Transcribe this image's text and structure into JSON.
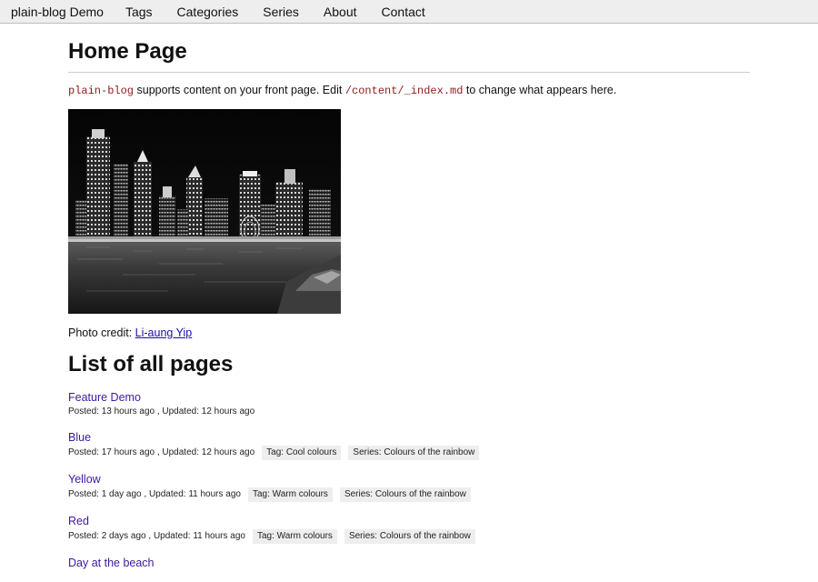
{
  "nav": {
    "brand": "plain-blog Demo",
    "items": [
      "Tags",
      "Categories",
      "Series",
      "About",
      "Contact"
    ]
  },
  "page": {
    "title": "Home Page",
    "intro": {
      "code1": "plain-blog",
      "text1": " supports content on your front page. Edit ",
      "code2": "/content/_index.md",
      "text2": " to change what appears here."
    },
    "photo_alt": "Night city skyline over water",
    "credit": {
      "label": "Photo credit: ",
      "name": "Li-aung Yip"
    },
    "section_title": "List of all pages"
  },
  "pages": [
    {
      "title": "Feature Demo",
      "meta": "Posted: 13 hours ago , Updated: 12 hours ago",
      "tag": "",
      "series": ""
    },
    {
      "title": "Blue",
      "meta": "Posted: 17 hours ago , Updated: 12 hours ago",
      "tag": "Tag: Cool colours",
      "series": "Series: Colours of the rainbow"
    },
    {
      "title": "Yellow",
      "meta": "Posted: 1 day ago , Updated: 11 hours ago",
      "tag": "Tag: Warm colours",
      "series": "Series: Colours of the rainbow"
    },
    {
      "title": "Red",
      "meta": "Posted: 2 days ago , Updated: 11 hours ago",
      "tag": "Tag: Warm colours",
      "series": "Series: Colours of the rainbow"
    },
    {
      "title": "Day at the beach",
      "meta": "",
      "tag": "",
      "series": ""
    }
  ]
}
